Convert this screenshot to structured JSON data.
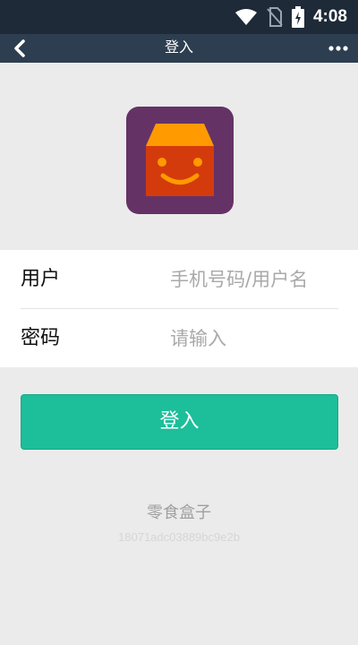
{
  "status_bar": {
    "time": "4:08",
    "icons": [
      "wifi-icon",
      "no-sim-icon",
      "battery-charging-icon"
    ]
  },
  "nav": {
    "title": "登入",
    "back_icon": "chevron-left-icon",
    "more_icon": "more-dots-icon"
  },
  "logo": {
    "icon": "smiling-box-logo",
    "colors": {
      "background": "#653266",
      "box_body": "#d43b0c",
      "box_lid": "#ff9a00"
    }
  },
  "form": {
    "username": {
      "label": "用户",
      "placeholder": "手机号码/用户名",
      "value": ""
    },
    "password": {
      "label": "密码",
      "placeholder": "请输入",
      "value": ""
    }
  },
  "login_button": {
    "label": "登入",
    "color": "#1dbe9a"
  },
  "footer": {
    "app_name": "零食盒子",
    "app_id": "18071adc03889bc9e2b"
  }
}
